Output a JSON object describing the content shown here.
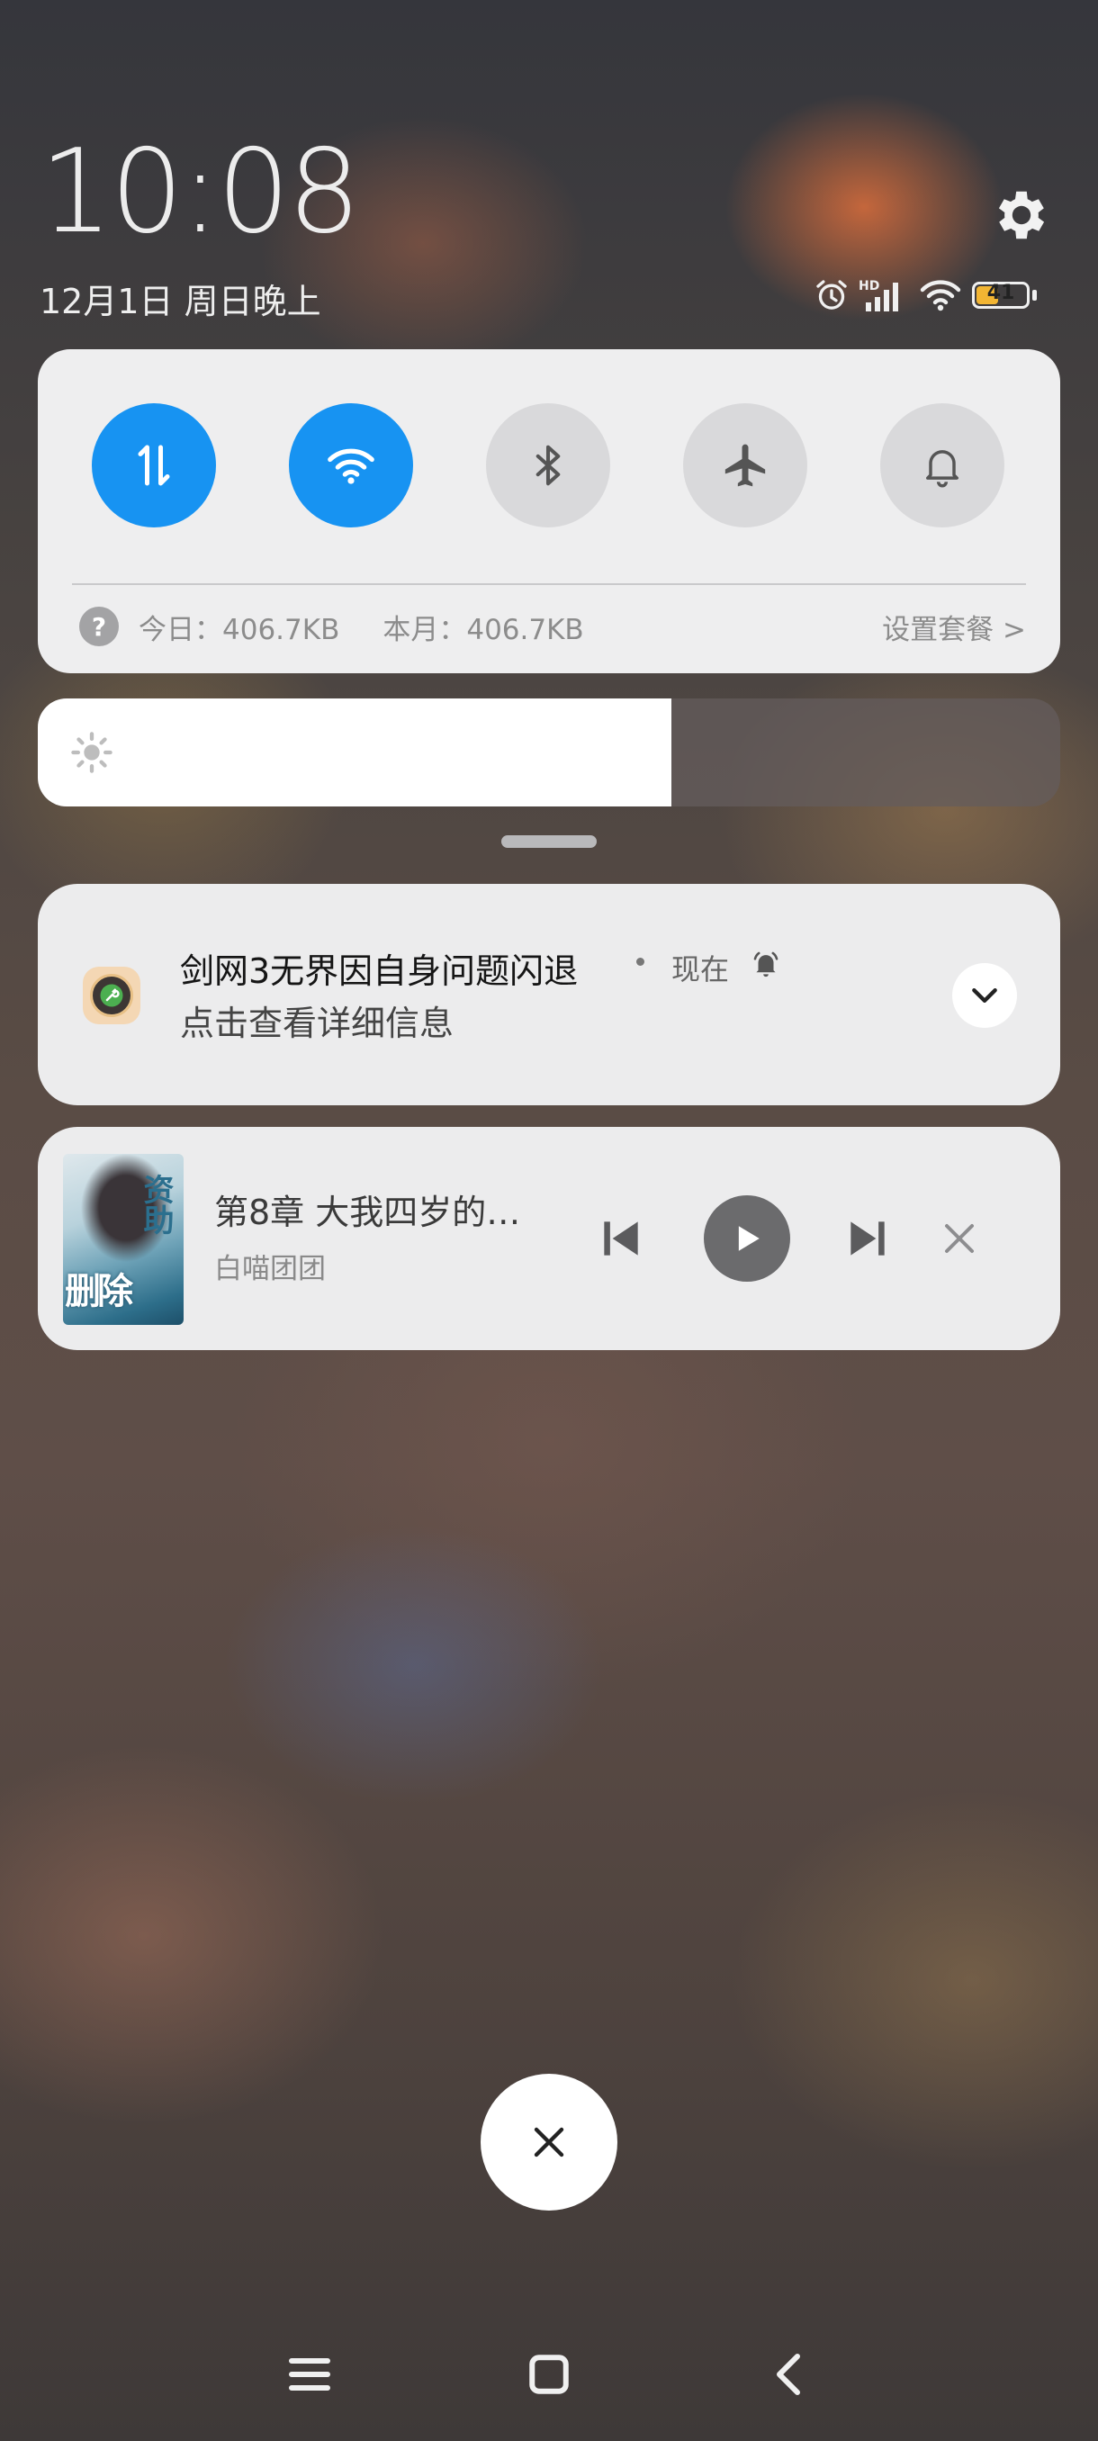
{
  "header": {
    "time": "10:08",
    "date": "12月1日 周日晚上",
    "battery_level": "41"
  },
  "quick_settings": {
    "toggles": [
      {
        "name": "mobile-data",
        "icon": "data-arrows-icon",
        "state": "on"
      },
      {
        "name": "wifi",
        "icon": "wifi-icon",
        "state": "on"
      },
      {
        "name": "bluetooth",
        "icon": "bluetooth-icon",
        "state": "off"
      },
      {
        "name": "airplane-mode",
        "icon": "airplane-icon",
        "state": "off"
      },
      {
        "name": "notification-sound",
        "icon": "bell-icon",
        "state": "off"
      }
    ],
    "data_today": "今日：406.7KB",
    "data_month": "本月：406.7KB",
    "plan_link": "设置套餐 >",
    "accent_color": "#1793f2"
  },
  "brightness": {
    "level": 0.62
  },
  "notification": {
    "title": "剑网3无界因自身问题闪退",
    "time": "现在",
    "body": "点击查看详细信息"
  },
  "media": {
    "cover_text_1": "资助",
    "cover_text_2": "删除",
    "title": "第8章 大我四岁的…",
    "artist": "白喵团团"
  }
}
